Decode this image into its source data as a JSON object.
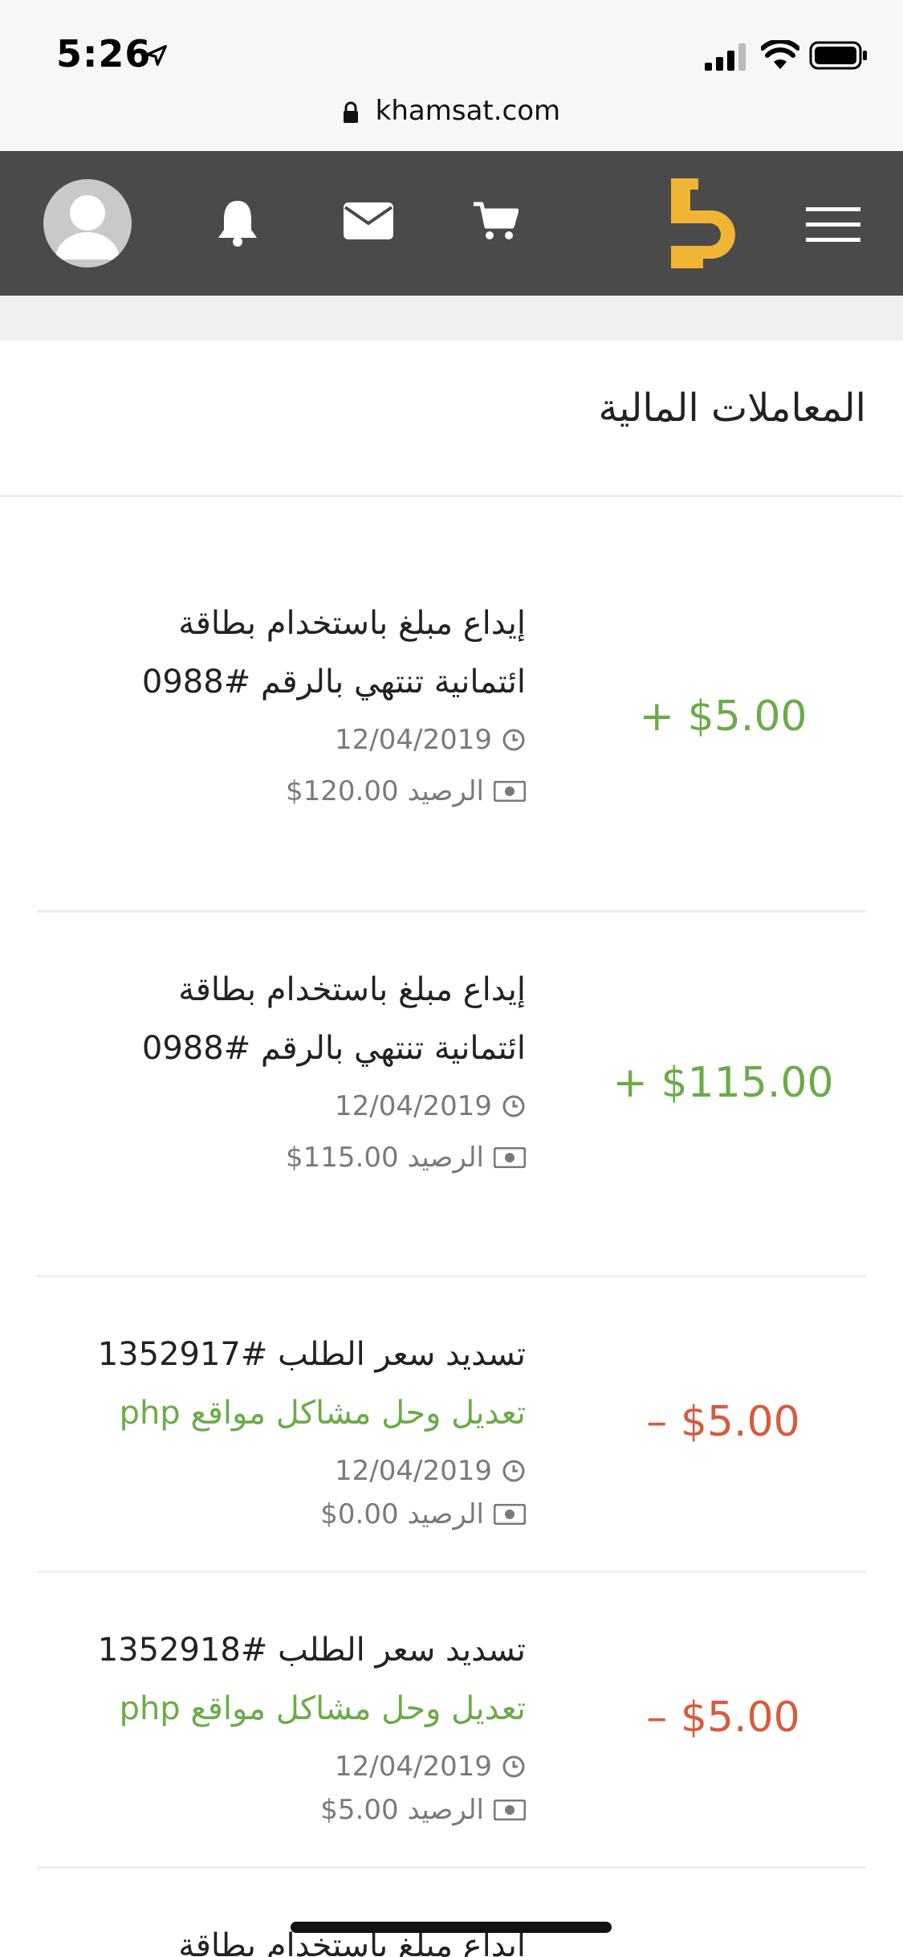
{
  "status_bar": {
    "time": "5:26",
    "url": "khamsat.com"
  },
  "header": {
    "icons": [
      "avatar",
      "bell-icon",
      "mail-icon",
      "cart-icon",
      "logo",
      "menu-icon"
    ],
    "logo_color": "#f1b434",
    "background": "#4a4a4a"
  },
  "page": {
    "title": "المعاملات المالية"
  },
  "transactions": [
    {
      "title_line1": "إيداع مبلغ باستخدام بطاقة",
      "title_line2": "ائتمانية تنتهي بالرقم #0988",
      "date": "12/04/2019",
      "balance_label": "الرصيد",
      "balance": "$120.00",
      "amount": "+ $5.00",
      "type": "credit"
    },
    {
      "title_line1": "إيداع مبلغ باستخدام بطاقة",
      "title_line2": "ائتمانية تنتهي بالرقم #0988",
      "date": "12/04/2019",
      "balance_label": "الرصيد",
      "balance": "$115.00",
      "amount": "+ $115.00",
      "type": "credit"
    },
    {
      "title_line1": "تسديد سعر الطلب #1352917",
      "link": "تعديل وحل مشاكل مواقع php",
      "date": "12/04/2019",
      "balance_label": "الرصيد",
      "balance": "$0.00",
      "amount": "– $5.00",
      "type": "debit"
    },
    {
      "title_line1": "تسديد سعر الطلب #1352918",
      "link": "تعديل وحل مشاكل مواقع php",
      "date": "12/04/2019",
      "balance_label": "الرصيد",
      "balance": "$5.00",
      "amount": "– $5.00",
      "type": "debit"
    },
    {
      "title_line1": "إيداع مبلغ باستخدام بطاقة"
    }
  ],
  "colors": {
    "credit": "#6aac48",
    "debit": "#d65c3e"
  }
}
